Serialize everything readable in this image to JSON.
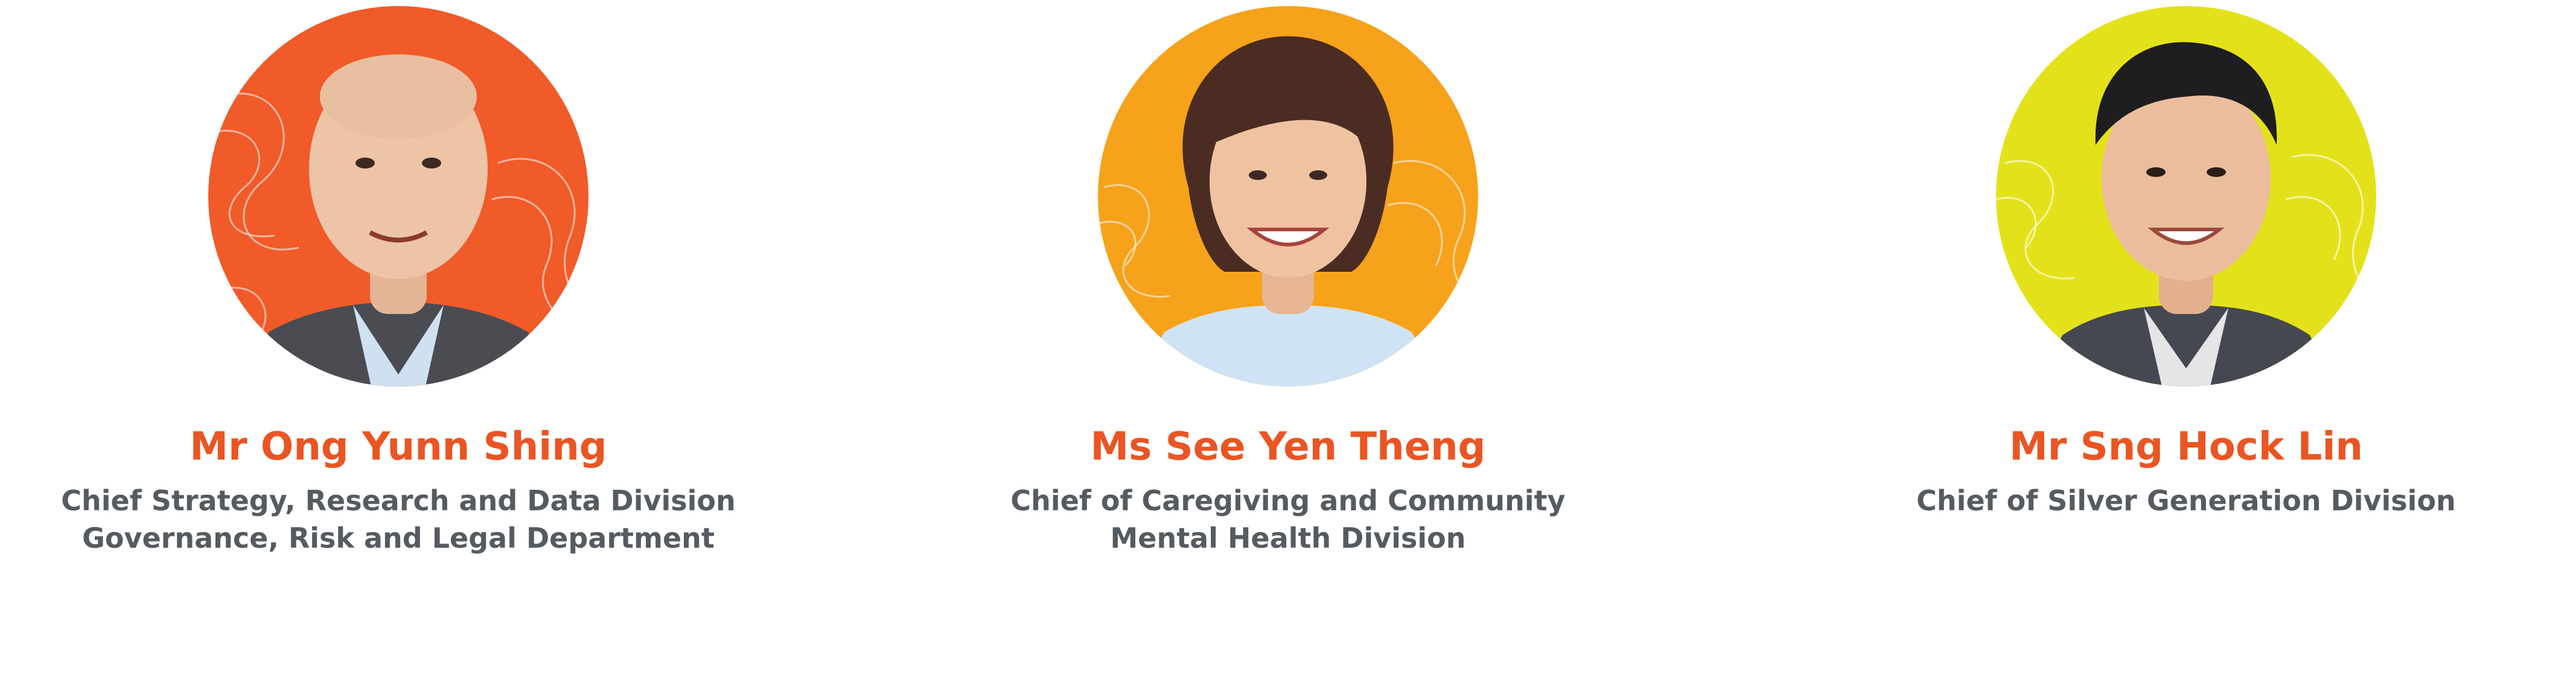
{
  "accent_color": "#ea5523",
  "text_color": "#555b60",
  "profiles": [
    {
      "name": "Mr Ong Yunn Shing",
      "role_lines": [
        "Chief Strategy, Research and Data Division",
        "Governance, Risk and Legal Department"
      ],
      "circle_color": "#f15a29",
      "icon": "portrait-photo"
    },
    {
      "name": "Ms See Yen Theng",
      "role_lines": [
        "Chief of Caregiving and Community",
        "Mental Health Division"
      ],
      "circle_color": "#f7a21b",
      "icon": "portrait-photo"
    },
    {
      "name": "Mr Sng Hock Lin",
      "role_lines": [
        "Chief of Silver Generation Division"
      ],
      "circle_color": "#e3e21a",
      "icon": "portrait-photo"
    }
  ]
}
